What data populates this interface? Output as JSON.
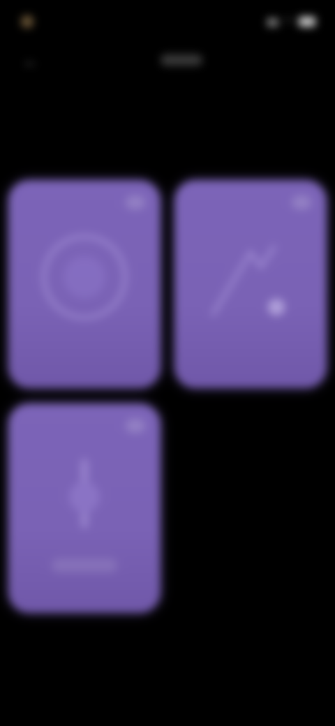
{
  "status_bar": {
    "time": "",
    "icons": [
      "signal-icon",
      "wifi-icon",
      "battery-icon"
    ]
  },
  "toolbar": {
    "back_icon": "back-arrow-icon",
    "center_label": ""
  },
  "page": {
    "title": "",
    "subtitle": ""
  },
  "cards": [
    {
      "label": "",
      "icon": "circle-illustration-icon"
    },
    {
      "label": "",
      "icon": "sparkle-illustration-icon"
    },
    {
      "label": "",
      "icon": "figure-illustration-icon"
    }
  ],
  "colors": {
    "background": "#000000",
    "card": "#7c64b8",
    "title": "#d4d4d4",
    "subtitle": "#6e6e6e"
  }
}
